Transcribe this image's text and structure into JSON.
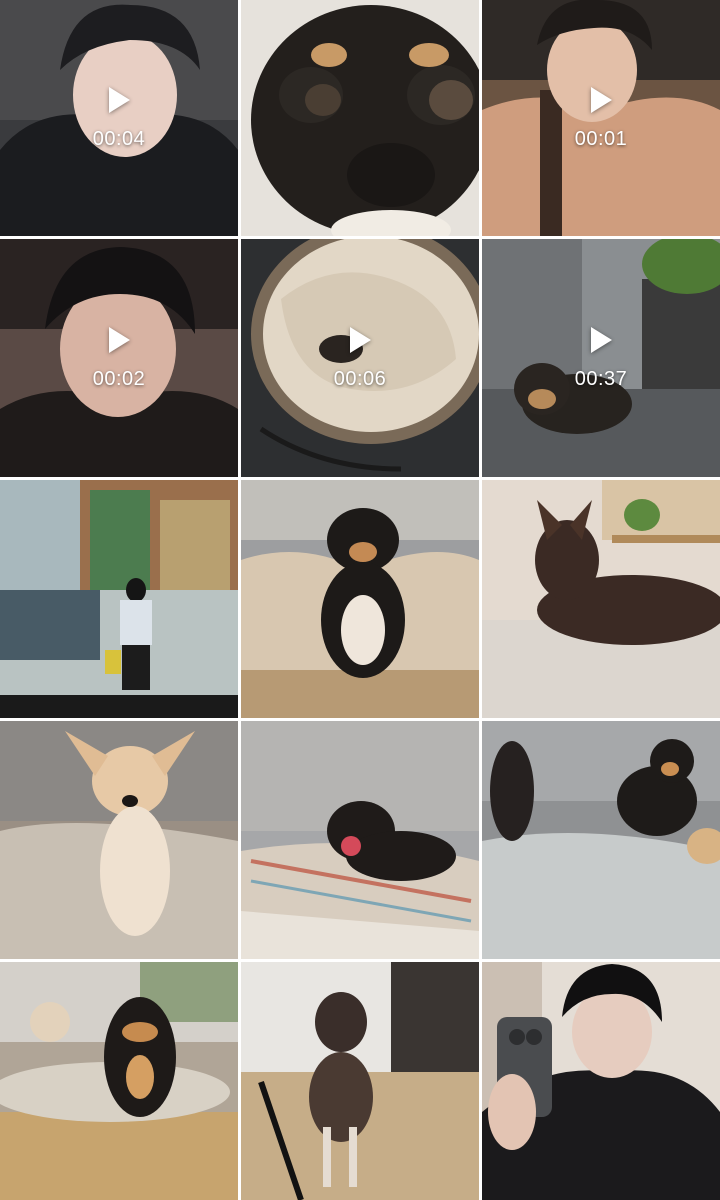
{
  "gallery": {
    "tiles": [
      {
        "kind": "video",
        "icon": "play-icon",
        "duration": "00:04",
        "subject": "person-selfie"
      },
      {
        "kind": "photo",
        "subject": "chihuahua-closeup"
      },
      {
        "kind": "video",
        "icon": "play-icon",
        "duration": "00:01",
        "subject": "person-selfie"
      },
      {
        "kind": "video",
        "icon": "play-icon",
        "duration": "00:02",
        "subject": "person-selfie"
      },
      {
        "kind": "video",
        "icon": "play-icon",
        "duration": "00:06",
        "subject": "dog-in-basket"
      },
      {
        "kind": "video",
        "icon": "play-icon",
        "duration": "00:37",
        "subject": "dog-outdoors"
      },
      {
        "kind": "photo",
        "subject": "store-cctv-screen"
      },
      {
        "kind": "photo",
        "subject": "dog-on-blanket"
      },
      {
        "kind": "photo",
        "subject": "dog-on-couch"
      },
      {
        "kind": "photo",
        "subject": "tan-chihuahua"
      },
      {
        "kind": "photo",
        "subject": "dog-on-plaid-blanket"
      },
      {
        "kind": "photo",
        "subject": "two-dogs-couch"
      },
      {
        "kind": "photo",
        "subject": "two-dogs-floor"
      },
      {
        "kind": "photo",
        "subject": "old-dog-standing"
      },
      {
        "kind": "photo",
        "subject": "person-mirror-selfie"
      }
    ]
  },
  "colors": {
    "background": "#ffffff",
    "overlay_text": "#ffffff"
  }
}
